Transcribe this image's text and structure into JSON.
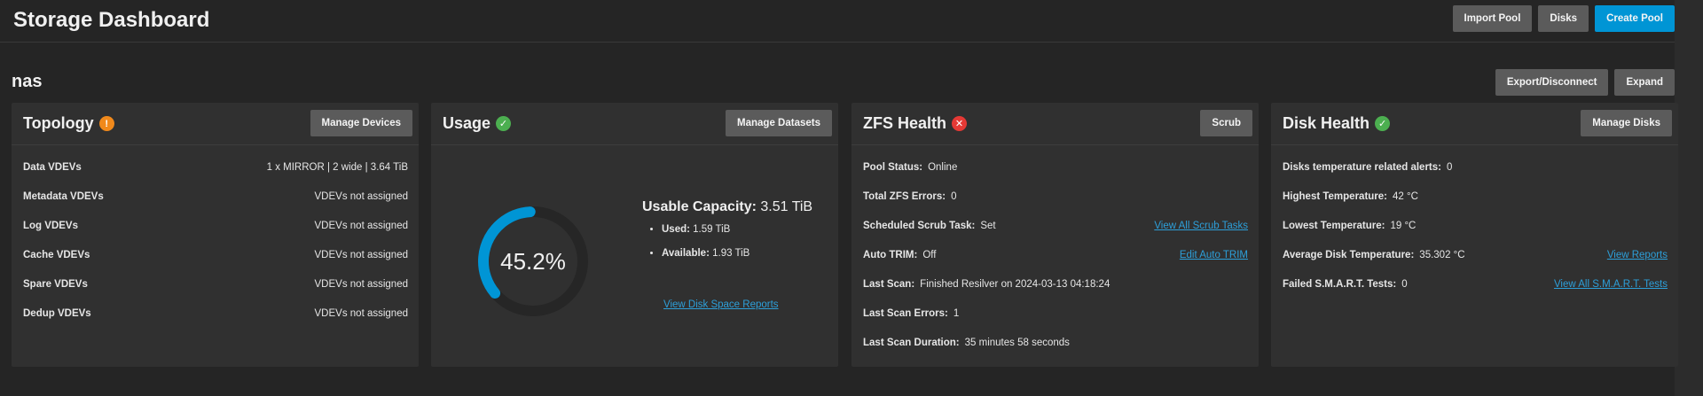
{
  "header": {
    "title": "Storage Dashboard",
    "import_pool": "Import Pool",
    "disks": "Disks",
    "create_pool": "Create Pool"
  },
  "pool": {
    "name": "nas",
    "export_disconnect": "Export/Disconnect",
    "expand": "Expand"
  },
  "topology": {
    "title": "Topology",
    "button": "Manage Devices",
    "rows": [
      {
        "label": "Data VDEVs",
        "value": "1 x MIRROR | 2 wide | 3.64 TiB"
      },
      {
        "label": "Metadata VDEVs",
        "value": "VDEVs not assigned"
      },
      {
        "label": "Log VDEVs",
        "value": "VDEVs not assigned"
      },
      {
        "label": "Cache VDEVs",
        "value": "VDEVs not assigned"
      },
      {
        "label": "Spare VDEVs",
        "value": "VDEVs not assigned"
      },
      {
        "label": "Dedup VDEVs",
        "value": "VDEVs not assigned"
      }
    ]
  },
  "usage": {
    "title": "Usage",
    "button": "Manage Datasets",
    "percent_text": "45.2%",
    "percent": 45.2,
    "capacity_label": "Usable Capacity:",
    "capacity_value": "3.51 TiB",
    "used_label": "Used:",
    "used_value": "1.59 TiB",
    "available_label": "Available:",
    "available_value": "1.93 TiB",
    "link": "View Disk Space Reports"
  },
  "zfs": {
    "title": "ZFS Health",
    "button": "Scrub",
    "rows": [
      {
        "label": "Pool Status:",
        "value": "Online",
        "link": ""
      },
      {
        "label": "Total ZFS Errors:",
        "value": "0",
        "link": ""
      },
      {
        "label": "Scheduled Scrub Task:",
        "value": "Set",
        "link": "View All Scrub Tasks"
      },
      {
        "label": "Auto TRIM:",
        "value": "Off",
        "link": "Edit Auto TRIM"
      },
      {
        "label": "Last Scan:",
        "value": "Finished Resilver on 2024-03-13 04:18:24",
        "link": ""
      },
      {
        "label": "Last Scan Errors:",
        "value": "1",
        "link": ""
      },
      {
        "label": "Last Scan Duration:",
        "value": "35 minutes 58 seconds",
        "link": ""
      }
    ]
  },
  "disk": {
    "title": "Disk Health",
    "button": "Manage Disks",
    "rows": [
      {
        "label": "Disks temperature related alerts:",
        "value": "0",
        "link": ""
      },
      {
        "label": "Highest Temperature:",
        "value": "42 °C",
        "link": ""
      },
      {
        "label": "Lowest Temperature:",
        "value": "19 °C",
        "link": ""
      },
      {
        "label": "Average Disk Temperature:",
        "value": "35.302 °C",
        "link": "View Reports"
      },
      {
        "label": "Failed S.M.A.R.T. Tests:",
        "value": "0",
        "link": "View All S.M.A.R.T. Tests"
      }
    ]
  },
  "colors": {
    "accent": "#0095d5",
    "ok": "#4caf50",
    "warn": "#f0891b",
    "error": "#e53935",
    "link": "#2d9fd9"
  },
  "icons": {
    "topology_status": "warning-icon",
    "usage_status": "check-circle-icon",
    "zfs_status": "error-x-icon",
    "disk_status": "check-circle-icon"
  }
}
